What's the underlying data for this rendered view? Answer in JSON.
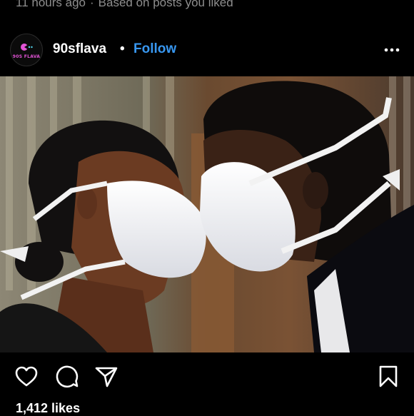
{
  "post": {
    "time_ago": "11 hours ago",
    "recommendation": "Based on posts you liked",
    "username": "90sflava",
    "follow_label": "Follow",
    "avatar_text": "90S FLAVA",
    "likes": "1,412 likes"
  },
  "icons": {
    "like": "heart-outline-icon",
    "comment": "speech-bubble-icon",
    "share": "paper-plane-icon",
    "save": "bookmark-outline-icon",
    "more": "three-dots-icon"
  },
  "colors": {
    "background": "#000000",
    "follow": "#3897f0",
    "muted_text": "#8e8e8e",
    "avatar_logo": "#e254d6"
  }
}
